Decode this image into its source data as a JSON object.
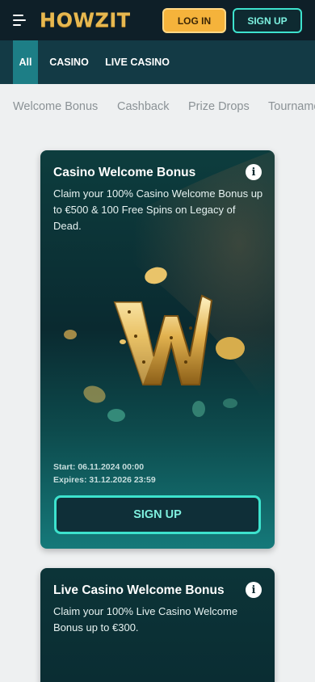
{
  "header": {
    "logo_text": "HOWZIT",
    "login_label": "LOG IN",
    "signup_label": "SIGN UP"
  },
  "category_tabs": [
    {
      "label": "All",
      "active": true
    },
    {
      "label": "CASINO",
      "active": false
    },
    {
      "label": "LIVE CASINO",
      "active": false
    }
  ],
  "promo_tabs": [
    "Welcome Bonus",
    "Cashback",
    "Prize Drops",
    "Tournaments"
  ],
  "promotions": [
    {
      "title": "Casino Welcome Bonus",
      "description": "Claim your 100% Casino Welcome Bonus up to €500 & 100 Free Spins on Legacy of Dead.",
      "start": "Start: 06.11.2024 00:00",
      "expires": "Expires: 31.12.2026 23:59",
      "button_label": "SIGN UP"
    },
    {
      "title": "Live Casino Welcome Bonus",
      "description": "Claim your 100% Live Casino Welcome Bonus up to €300."
    }
  ],
  "colors": {
    "header_bg": "#0e1f28",
    "nav_bg": "#133a45",
    "active_tab": "#1d7e86",
    "login_yellow": "#f5b33b",
    "teal_accent": "#3de2cd",
    "gold": "#e7b850"
  },
  "icons": {
    "menu": "menu-icon",
    "info": "info-icon",
    "hero_art": "gold-w-logo-icon"
  }
}
